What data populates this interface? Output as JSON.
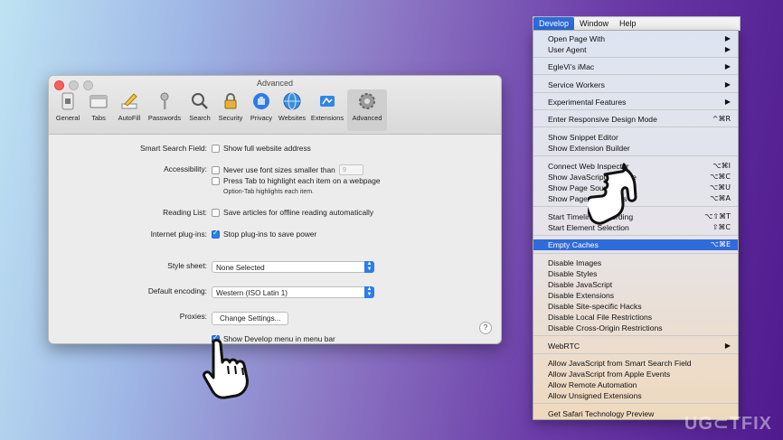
{
  "window": {
    "title": "Advanced",
    "toolbar": [
      {
        "label": "General",
        "icon": "general-switch-icon"
      },
      {
        "label": "Tabs",
        "icon": "tabs-icon"
      },
      {
        "label": "AutoFill",
        "icon": "autofill-pencil-icon"
      },
      {
        "label": "Passwords",
        "icon": "key-icon"
      },
      {
        "label": "Search",
        "icon": "magnifier-icon"
      },
      {
        "label": "Security",
        "icon": "padlock-icon"
      },
      {
        "label": "Privacy",
        "icon": "privacy-hand-icon"
      },
      {
        "label": "Websites",
        "icon": "globe-icon"
      },
      {
        "label": "Extensions",
        "icon": "puzzle-icon"
      },
      {
        "label": "Advanced",
        "icon": "gear-icon",
        "selected": true
      }
    ],
    "smart_search": {
      "label": "Smart Search Field:",
      "option": "Show full website address"
    },
    "accessibility": {
      "label": "Accessibility:",
      "opt1": "Never use font sizes smaller than",
      "font_size": "9",
      "opt2": "Press Tab to highlight each item on a webpage",
      "hint": "Option-Tab highlights each item."
    },
    "reading_list": {
      "label": "Reading List:",
      "option": "Save articles for offline reading automatically"
    },
    "plugins": {
      "label": "Internet plug-ins:",
      "option": "Stop plug-ins to save power"
    },
    "style_sheet": {
      "label": "Style sheet:",
      "value": "None Selected"
    },
    "encoding": {
      "label": "Default encoding:",
      "value": "Western (ISO Latin 1)"
    },
    "proxies": {
      "label": "Proxies:",
      "button": "Change Settings..."
    },
    "develop": {
      "option": "Show Develop menu in menu bar"
    },
    "help": "?"
  },
  "menubar": {
    "items": [
      "Develop",
      "Window",
      "Help"
    ]
  },
  "menu": {
    "items": [
      {
        "label": "Open Page With",
        "k": "▶"
      },
      {
        "label": "User Agent",
        "k": "▶"
      },
      {
        "label": "EgleVi's iMac",
        "k": "▶"
      },
      {
        "label": "Service Workers",
        "k": "▶"
      },
      {
        "label": "Experimental Features",
        "k": "▶"
      },
      {
        "label": "Enter Responsive Design Mode",
        "k": "^⌘R"
      },
      {
        "label": "Show Snippet Editor",
        "k": ""
      },
      {
        "label": "Show Extension Builder",
        "k": ""
      },
      {
        "label": "Connect Web Inspector",
        "k": "⌥⌘I"
      },
      {
        "label": "Show JavaScript Console",
        "k": "⌥⌘C"
      },
      {
        "label": "Show Page Source",
        "k": "⌥⌘U"
      },
      {
        "label": "Show Page Resources",
        "k": "⌥⌘A"
      },
      {
        "label": "Start Timeline Recording",
        "k": "⌥⇧⌘T"
      },
      {
        "label": "Start Element Selection",
        "k": "⇧⌘C"
      },
      {
        "label": "Empty Caches",
        "k": "⌥⌘E"
      },
      {
        "label": "Disable Images",
        "k": ""
      },
      {
        "label": "Disable Styles",
        "k": ""
      },
      {
        "label": "Disable JavaScript",
        "k": ""
      },
      {
        "label": "Disable Extensions",
        "k": ""
      },
      {
        "label": "Disable Site-specific Hacks",
        "k": ""
      },
      {
        "label": "Disable Local File Restrictions",
        "k": ""
      },
      {
        "label": "Disable Cross-Origin Restrictions",
        "k": ""
      },
      {
        "label": "WebRTC",
        "k": "▶"
      },
      {
        "label": "Allow JavaScript from Smart Search Field",
        "k": ""
      },
      {
        "label": "Allow JavaScript from Apple Events",
        "k": ""
      },
      {
        "label": "Allow Remote Automation",
        "k": ""
      },
      {
        "label": "Allow Unsigned Extensions",
        "k": ""
      },
      {
        "label": "Get Safari Technology Preview",
        "k": ""
      }
    ]
  },
  "watermark": "UG⊂TFIX",
  "colors": {
    "accent": "#2f6bdb",
    "checkbox": "#2b7de9"
  }
}
